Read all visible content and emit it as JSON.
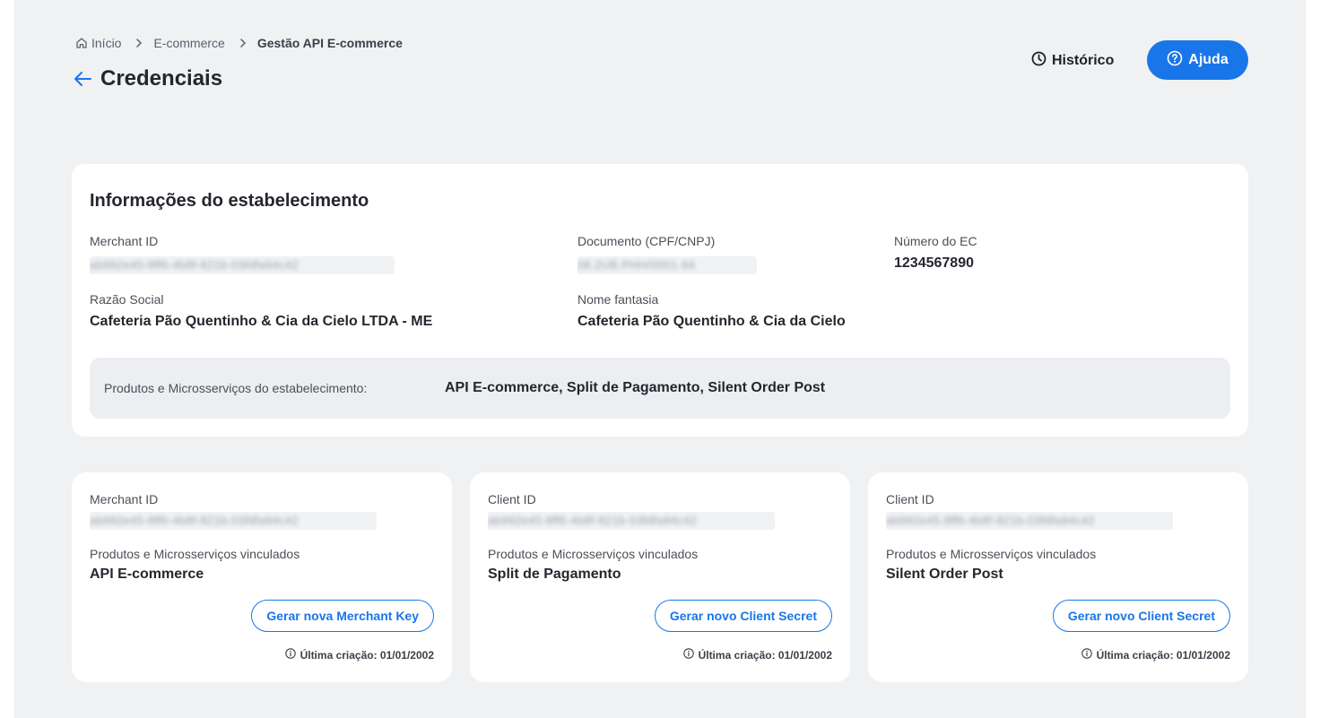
{
  "breadcrumb": {
    "home": "Início",
    "ecommerce": "E-commerce",
    "current": "Gestão API E-commerce"
  },
  "header": {
    "title": "Credenciais",
    "history_label": "Histórico",
    "help_label": "Ajuda"
  },
  "colors": {
    "accent": "#1976e8",
    "background": "#f0f1f3",
    "card": "#ffffff"
  },
  "establishment": {
    "title": "Informações do estabelecimento",
    "merchant_id_label": "Merchant ID",
    "merchant_id_value": "ab992e45-8ff6-4b8f-821b-03fdfa94c42",
    "document_label": "Documento (CPF/CNPJ)",
    "document_value": "08.2UB.PHH/0001-94",
    "ec_number_label": "Número do EC",
    "ec_number_value": "1234567890",
    "razao_social_label": "Razão Social",
    "razao_social_value": "Cafeteria Pão Quentinho & Cia da Cielo LTDA - ME",
    "nome_fantasia_label": "Nome fantasia",
    "nome_fantasia_value": "Cafeteria Pão Quentinho & Cia da Cielo",
    "products_label": "Produtos e Microsserviços do estabelecimento:",
    "products_value": "API E-commerce, Split de Pagamento, Silent Order Post"
  },
  "credentials": [
    {
      "id_label": "Merchant ID",
      "id_value": "ab992e45-8ff6-4b8f-821b-03fdfa94c42",
      "products_label": "Produtos e Microsserviços vinculados",
      "products_value": "API E-commerce",
      "button_label": "Gerar nova Merchant Key",
      "last_created": "Última criação: 01/01/2002"
    },
    {
      "id_label": "Client ID",
      "id_value": "ab992e45-8ff6-4b8f-821b-03fdfa94c42",
      "products_label": "Produtos e Microsserviços vinculados",
      "products_value": "Split de Pagamento",
      "button_label": "Gerar novo Client Secret",
      "last_created": "Última criação: 01/01/2002"
    },
    {
      "id_label": "Client ID",
      "id_value": "ab992e45-8ff6-4b8f-821b-03fdfa94c42",
      "products_label": "Produtos e Microsserviços vinculados",
      "products_value": "Silent Order Post",
      "button_label": "Gerar novo Client Secret",
      "last_created": "Última criação: 01/01/2002"
    }
  ]
}
